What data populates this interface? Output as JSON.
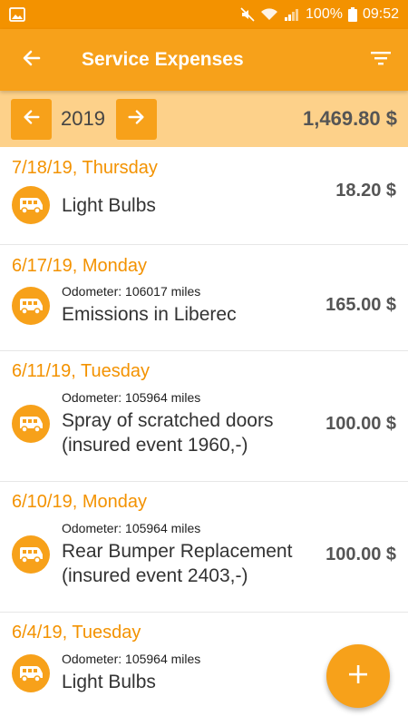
{
  "status_bar": {
    "battery": "100%",
    "time": "09:52"
  },
  "app_bar": {
    "title": "Service Expenses"
  },
  "year_bar": {
    "year": "2019",
    "total": "1,469.80 $"
  },
  "entries": [
    {
      "date": "7/18/19, Thursday",
      "odometer": "",
      "name": "Light Bulbs",
      "amount": "18.20 $"
    },
    {
      "date": "6/17/19, Monday",
      "odometer": "Odometer: 106017 miles",
      "name": "Emissions in Liberec",
      "amount": "165.00 $"
    },
    {
      "date": "6/11/19, Tuesday",
      "odometer": "Odometer: 105964 miles",
      "name": "Spray of scratched doors (insured event 1960,-)",
      "amount": "100.00 $"
    },
    {
      "date": "6/10/19, Monday",
      "odometer": "Odometer: 105964 miles",
      "name": "Rear Bumper Replacement (insured event 2403,-)",
      "amount": "100.00 $"
    },
    {
      "date": "6/4/19, Tuesday",
      "odometer": "Odometer: 105964 miles",
      "name": "Light Bulbs",
      "amount": ""
    }
  ],
  "fab": {
    "label": "+"
  },
  "colors": {
    "primary": "#F7A11A",
    "status_bar": "#F39200",
    "year_bar": "#FDD18A",
    "date_text": "#F39200"
  }
}
